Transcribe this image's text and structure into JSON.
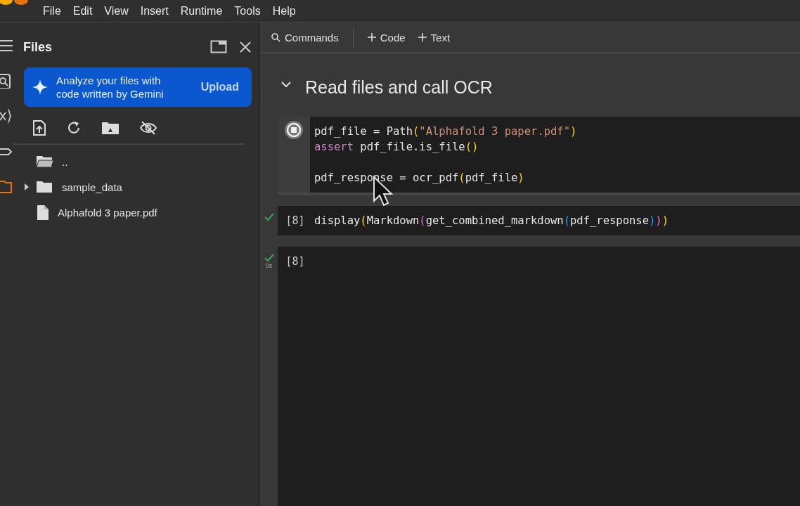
{
  "menu": [
    "File",
    "Edit",
    "View",
    "Insert",
    "Runtime",
    "Tools",
    "Help"
  ],
  "rail": [
    {
      "kind": "menu",
      "selected": false
    },
    {
      "kind": "search",
      "selected": false
    },
    {
      "kind": "variables",
      "selected": false
    },
    {
      "kind": "key",
      "selected": false
    },
    {
      "kind": "folder",
      "selected": true
    }
  ],
  "files_panel": {
    "title": "Files",
    "banner": {
      "text": "Analyze your files with code written by Gemini",
      "button": "Upload"
    },
    "tree": [
      {
        "kind": "parent",
        "name": ".."
      },
      {
        "kind": "folder",
        "name": "sample_data",
        "expanded": false
      },
      {
        "kind": "file",
        "name": "Alphafold 3 paper.pdf"
      }
    ]
  },
  "toolbar": [
    {
      "kind": "search",
      "label": "Commands"
    },
    {
      "kind": "add",
      "label": "Code"
    },
    {
      "kind": "add",
      "label": "Text"
    }
  ],
  "section": {
    "title": "Read files and call OCR",
    "expanded": true
  },
  "cells": [
    {
      "running": true,
      "succeeded": false,
      "lines": [
        {
          "kind": "code",
          "tokens": [
            {
              "kind": "plain",
              "text": "pdf_file = Path"
            },
            {
              "kind": "paren1",
              "text": "("
            },
            {
              "kind": "string",
              "text": "\"Alphafold 3 paper.pdf\""
            },
            {
              "kind": "paren1",
              "text": ")"
            }
          ]
        },
        {
          "kind": "code",
          "tokens": [
            {
              "kind": "keyword",
              "text": "assert"
            },
            {
              "kind": "plain",
              "text": " pdf_file.is_file"
            },
            {
              "kind": "paren1",
              "text": "()"
            }
          ]
        },
        {
          "kind": "blank"
        },
        {
          "kind": "code",
          "tokens": [
            {
              "kind": "plain",
              "text": "pdf_response = ocr_pdf"
            },
            {
              "kind": "paren1",
              "text": "("
            },
            {
              "kind": "plain",
              "text": "pdf_file"
            },
            {
              "kind": "paren1",
              "text": ")"
            }
          ]
        }
      ]
    },
    {
      "running": false,
      "succeeded": true,
      "exec_count": "[8]",
      "lines": [
        {
          "kind": "code",
          "tokens": [
            {
              "kind": "plain",
              "text": "display"
            },
            {
              "kind": "paren1",
              "text": "("
            },
            {
              "kind": "plain",
              "text": "Markdown"
            },
            {
              "kind": "paren2",
              "text": "("
            },
            {
              "kind": "plain",
              "text": "get_combined_markdown"
            },
            {
              "kind": "paren3",
              "text": "("
            },
            {
              "kind": "plain",
              "text": "pdf_response"
            },
            {
              "kind": "paren3",
              "text": ")"
            },
            {
              "kind": "paren2",
              "text": ")"
            },
            {
              "kind": "paren1",
              "text": ")"
            }
          ]
        }
      ]
    },
    {
      "running": false,
      "succeeded": true,
      "exec_count": "[8]",
      "time": "0s"
    }
  ]
}
